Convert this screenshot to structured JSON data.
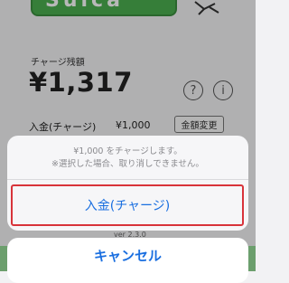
{
  "card": {
    "text": "Suica"
  },
  "balance": {
    "label": "チャージ残額",
    "value": "¥1,317"
  },
  "help_button": {
    "glyph": "?"
  },
  "info_button": {
    "glyph": "i"
  },
  "charge": {
    "label": "入金(チャージ)",
    "amount": "¥1,000",
    "change_label": "金額変更"
  },
  "version": "ver 2.3.0",
  "action_sheet": {
    "message_line1": "¥1,000 をチャージします。",
    "message_line2": "※選択した場合、取り消しできません。",
    "action_label": "入金(チャージ)",
    "cancel_label": "キャンセル"
  },
  "colors": {
    "accent": "#1a6fe0",
    "highlight": "#d8333a",
    "card_green": "#4caf50"
  }
}
